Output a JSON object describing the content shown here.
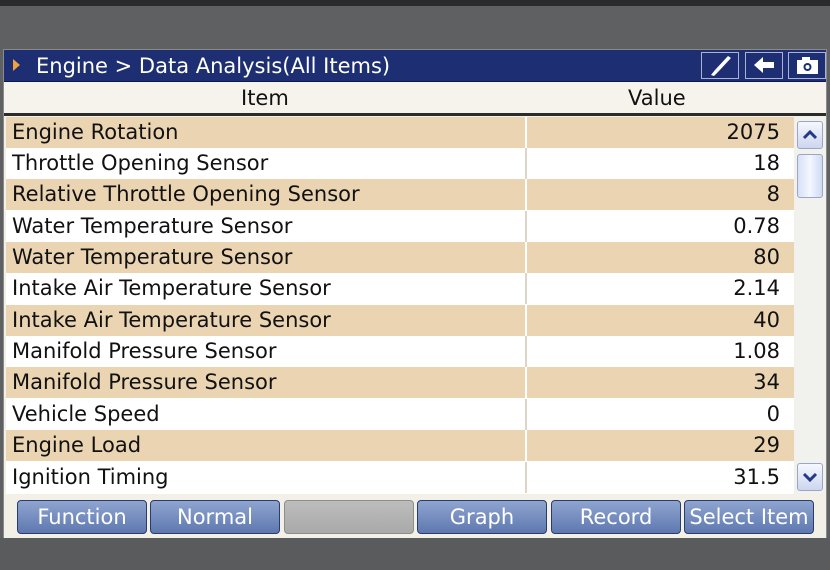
{
  "header": {
    "breadcrumb": "Engine > Data Analysis(All Items)",
    "icons": [
      "brush-icon",
      "back-arrow-icon",
      "camera-icon"
    ]
  },
  "columns": {
    "item": "Item",
    "value": "Value"
  },
  "rows": [
    {
      "item": "Engine Rotation",
      "value": "2075"
    },
    {
      "item": "Throttle Opening Sensor",
      "value": "18"
    },
    {
      "item": "Relative Throttle Opening Sensor",
      "value": "8"
    },
    {
      "item": "Water Temperature Sensor",
      "value": "0.78"
    },
    {
      "item": "Water Temperature Sensor",
      "value": "80"
    },
    {
      "item": "Intake Air Temperature Sensor",
      "value": "2.14"
    },
    {
      "item": "Intake Air Temperature Sensor",
      "value": "40"
    },
    {
      "item": "Manifold Pressure Sensor",
      "value": "1.08"
    },
    {
      "item": "Manifold Pressure Sensor",
      "value": "34"
    },
    {
      "item": "Vehicle Speed",
      "value": "0"
    },
    {
      "item": "Engine Load",
      "value": "29"
    },
    {
      "item": "Ignition Timing",
      "value": "31.5"
    }
  ],
  "toolbar": {
    "function_label": "Function",
    "normal_label": "Normal",
    "blank_label": "",
    "graph_label": "Graph",
    "record_label": "Record",
    "select_item_label": "Select Item"
  },
  "colors": {
    "title_bar": "#1d2f72",
    "row_alt": "#ead4b2",
    "button": "#6f88bd",
    "accent_arrow": "#f2a13a"
  }
}
